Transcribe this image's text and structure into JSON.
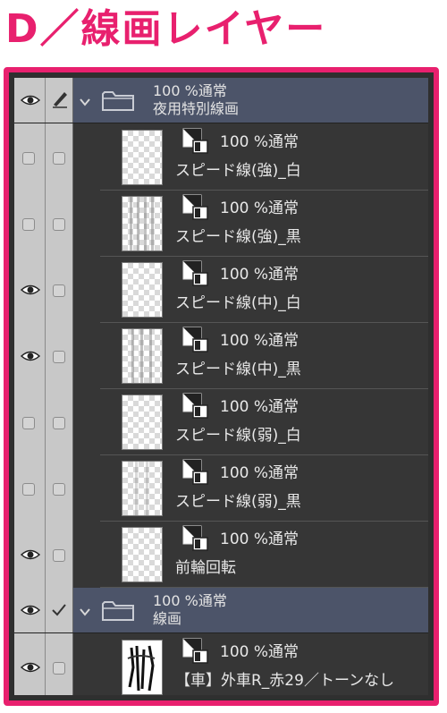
{
  "title": "D／線画レイヤー",
  "colors": {
    "accent": "#e8206e",
    "group_band": "#4c5469",
    "panel_bg": "#363636"
  },
  "layers": [
    {
      "kind": "group",
      "opacity_mode": "100 %通常",
      "name": "夜用特別線画",
      "visible": true,
      "lock_icon": "pen-icon"
    },
    {
      "kind": "layer",
      "opacity_mode": "100 %通常",
      "name": "スピード線(強)_白",
      "visible": false,
      "thumb": "blank"
    },
    {
      "kind": "layer",
      "opacity_mode": "100 %通常",
      "name": "スピード線(強)_黒",
      "visible": false,
      "thumb": "streaks"
    },
    {
      "kind": "layer",
      "opacity_mode": "100 %通常",
      "name": "スピード線(中)_白",
      "visible": true,
      "thumb": "blank"
    },
    {
      "kind": "layer",
      "opacity_mode": "100 %通常",
      "name": "スピード線(中)_黒",
      "visible": true,
      "thumb": "streaks"
    },
    {
      "kind": "layer",
      "opacity_mode": "100 %通常",
      "name": "スピード線(弱)_白",
      "visible": false,
      "thumb": "blank"
    },
    {
      "kind": "layer",
      "opacity_mode": "100 %通常",
      "name": "スピード線(弱)_黒",
      "visible": false,
      "thumb": "streaks"
    },
    {
      "kind": "layer",
      "opacity_mode": "100 %通常",
      "name": "前輪回転",
      "visible": true,
      "thumb": "blank"
    },
    {
      "kind": "group",
      "opacity_mode": "100 %通常",
      "name": "線画",
      "visible": true,
      "lock_icon": "check-icon"
    },
    {
      "kind": "layer",
      "opacity_mode": "100 %通常",
      "name": "【車】外車R_赤29／トーンなし",
      "visible": true,
      "thumb": "car"
    }
  ]
}
